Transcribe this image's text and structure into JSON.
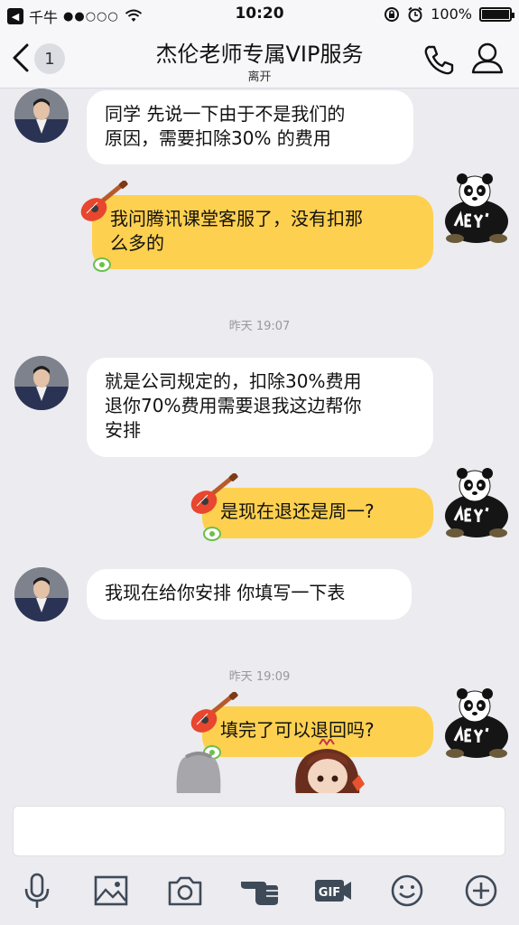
{
  "status_bar": {
    "carrier": "千牛",
    "signal": "●●○○○",
    "time": "10:20",
    "battery": "100%"
  },
  "nav": {
    "unread_count": "1",
    "title": "杰伦老师专属VIP服务",
    "subtitle": "离开"
  },
  "messages": {
    "m1": {
      "line1": "同学 先说一下由于不是我们的",
      "line2": "原因，需要扣除30% 的费用"
    },
    "m2": {
      "line1": "我问腾讯课堂客服了，没有扣那",
      "line2": "么多的"
    },
    "sep1": "昨天 19:07",
    "m3": {
      "line1": "就是公司规定的，扣除30%费用",
      "line2": "退你70%费用需要退我这边帮你",
      "line3": "安排"
    },
    "m4": {
      "text": "是现在退还是周一?"
    },
    "m5": {
      "text": "我现在给你安排 你填写一下表"
    },
    "sep2": "昨天 19:09",
    "m6": {
      "text": "填完了可以退回吗?"
    }
  },
  "input": {
    "placeholder": ""
  },
  "toolbar_icons": [
    "mic-icon",
    "image-icon",
    "camera-icon",
    "poke-icon",
    "gif-icon",
    "emoji-icon",
    "plus-icon"
  ],
  "colors": {
    "outgoing_bubble": "#fdd04f",
    "incoming_bubble": "#ffffff",
    "background": "#ebebf0"
  }
}
